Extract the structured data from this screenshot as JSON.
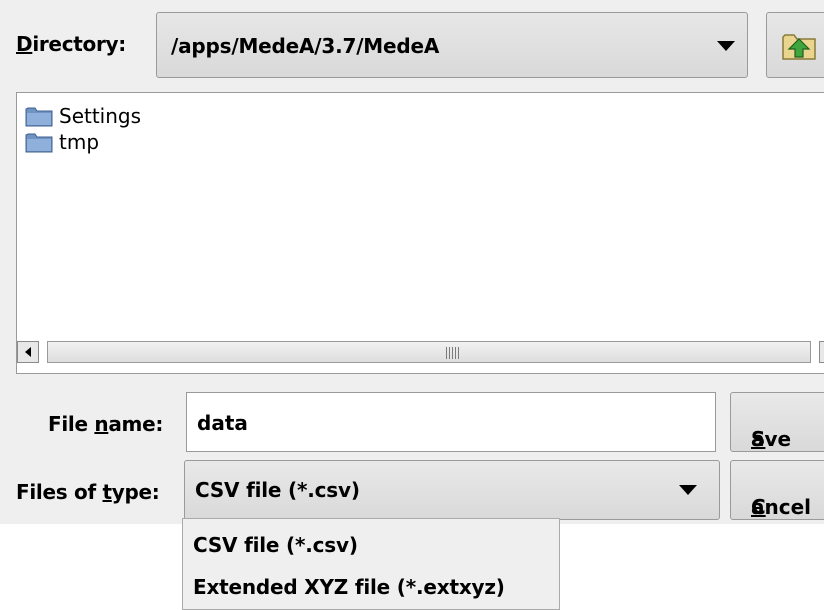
{
  "directory": {
    "label": "Directory:",
    "mnemonic": "D",
    "value": "/apps/MedeA/3.7/MedeA",
    "up_icon": "up-folder-icon"
  },
  "file_list": {
    "items": [
      {
        "name": "Settings",
        "icon": "folder-icon"
      },
      {
        "name": "tmp",
        "icon": "folder-icon"
      }
    ]
  },
  "file_name": {
    "label_pre": "File ",
    "label_mnemonic": "n",
    "label_post": "ame:",
    "value": "data"
  },
  "file_type": {
    "label_pre": "Files of ",
    "label_mnemonic": "t",
    "label_post": "ype:",
    "value": "CSV file (*.csv)",
    "options": [
      "CSV file (*.csv)",
      "Extended XYZ file (*.extxyz)"
    ]
  },
  "buttons": {
    "save_mnemonic": "S",
    "save_rest": "ave",
    "cancel_mnemonic": "C",
    "cancel_rest": "ancel"
  },
  "colors": {
    "dialog_bg": "#efefef",
    "folder_blue": "#6f93c2",
    "up_arrow_green": "#3fa63f"
  }
}
